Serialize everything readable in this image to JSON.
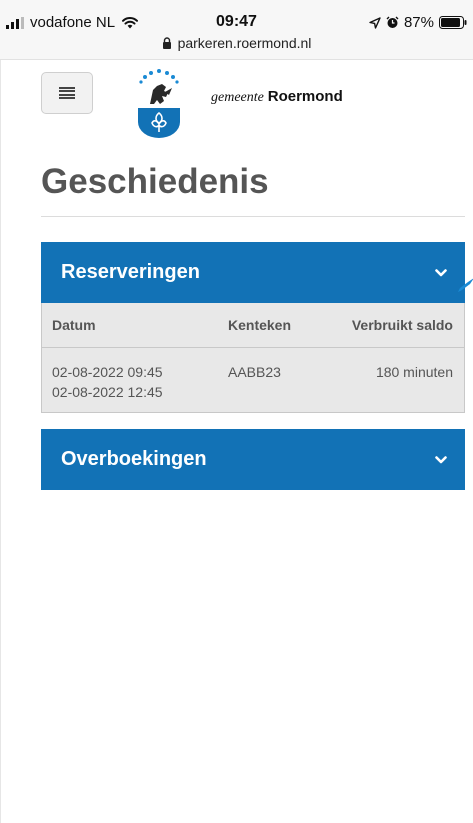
{
  "status_bar": {
    "carrier": "vodafone NL",
    "time": "09:47",
    "battery": "87%",
    "url": "parkeren.roermond.nl"
  },
  "header": {
    "logo_prefix": "gemeente",
    "logo_brand": "Roermond"
  },
  "page": {
    "title": "Geschiedenis"
  },
  "reserveringen": {
    "label": "Reserveringen",
    "columns": {
      "datum": "Datum",
      "kenteken": "Kenteken",
      "saldo": "Verbruikt saldo"
    },
    "rows": [
      {
        "start": "02-08-2022 09:45",
        "end": "02-08-2022 12:45",
        "kenteken": "AABB23",
        "saldo": "180 minuten"
      }
    ]
  },
  "overboekingen": {
    "label": "Overboekingen"
  },
  "icons": {
    "signal": "signal-icon",
    "wifi": "wifi-icon",
    "location": "location-arrow-icon",
    "alarm": "alarm-icon",
    "battery": "battery-icon",
    "lock": "lock-icon",
    "menu": "hamburger-menu-icon",
    "chevron": "chevron-down-icon",
    "logo": "roermond-crest-icon"
  },
  "colors": {
    "brand_blue": "#1272b6",
    "title_gray": "#555555",
    "table_bg": "#e8e8e8"
  }
}
